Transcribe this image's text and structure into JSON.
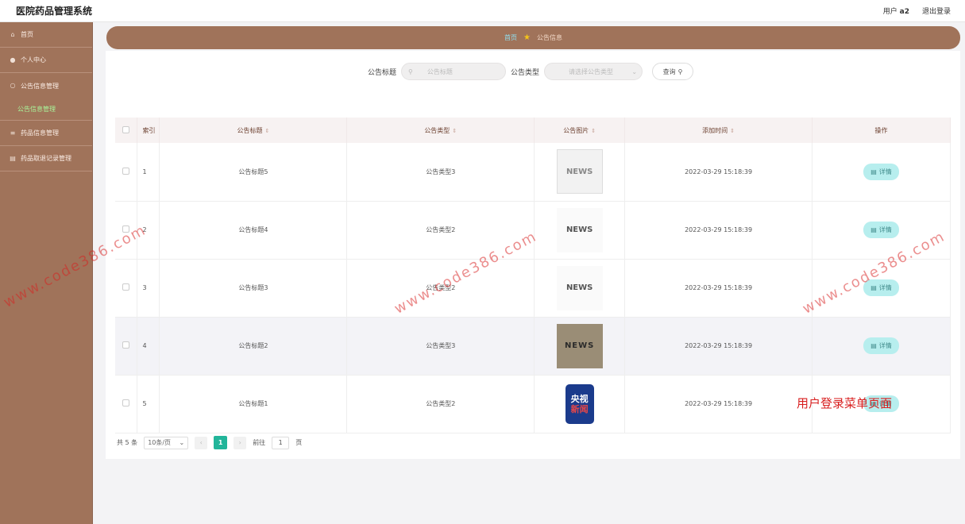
{
  "header": {
    "title": "医院药品管理系统",
    "user_label": "用户",
    "username": "a2",
    "logout": "退出登录"
  },
  "sidebar": {
    "items": [
      {
        "label": "首页",
        "icon": "home-icon"
      },
      {
        "label": "个人中心",
        "icon": "user-icon"
      },
      {
        "label": "公告信息管理",
        "icon": "notice-icon"
      },
      {
        "label": "公告信息管理",
        "icon": "",
        "active": true
      },
      {
        "label": "药品信息管理",
        "icon": "list-icon"
      },
      {
        "label": "药品取退记录管理",
        "icon": "record-icon"
      }
    ]
  },
  "breadcrumb": {
    "home": "首页",
    "current": "公告信息"
  },
  "search": {
    "title_label": "公告标题",
    "title_placeholder": "公告标题",
    "type_label": "公告类型",
    "type_placeholder": "请选择公告类型",
    "query_button": "查询"
  },
  "table": {
    "headers": {
      "index": "索引",
      "title": "公告标题",
      "type": "公告类型",
      "image": "公告图片",
      "time": "添加时间",
      "ops": "操作"
    },
    "rows": [
      {
        "index": "1",
        "title": "公告标题5",
        "type": "公告类型3",
        "image": "news-pencil",
        "time": "2022-03-29 15:18:39",
        "action": "详情"
      },
      {
        "index": "2",
        "title": "公告标题4",
        "type": "公告类型2",
        "image": "news-magnifier",
        "time": "2022-03-29 15:18:39",
        "action": "详情"
      },
      {
        "index": "3",
        "title": "公告标题3",
        "type": "公告类型2",
        "image": "news-magnifier",
        "time": "2022-03-29 15:18:39",
        "action": "详情"
      },
      {
        "index": "4",
        "title": "公告标题2",
        "type": "公告类型3",
        "image": "news-blocks",
        "time": "2022-03-29 15:18:39",
        "action": "详情"
      },
      {
        "index": "5",
        "title": "公告标题1",
        "type": "公告类型2",
        "image": "cctv-news",
        "time": "2022-03-29 15:18:39",
        "action": "详情"
      }
    ],
    "thumb_texts": {
      "t1": "NEWS",
      "t2": "NEWS",
      "t3": "NEWS",
      "t4_top": "央视",
      "t4_bottom": "新闻"
    }
  },
  "pagination": {
    "total": "共 5 条",
    "page_size": "10条/页",
    "current": "1",
    "goto_prefix": "前往",
    "goto_value": "1",
    "goto_suffix": "页"
  },
  "watermark": "www.code386.com",
  "overlay_label": "用户登录菜单页面",
  "colors": {
    "sidebar": "#a0735a",
    "accent": "#22b59a",
    "detail_button": "#b7eeee"
  }
}
